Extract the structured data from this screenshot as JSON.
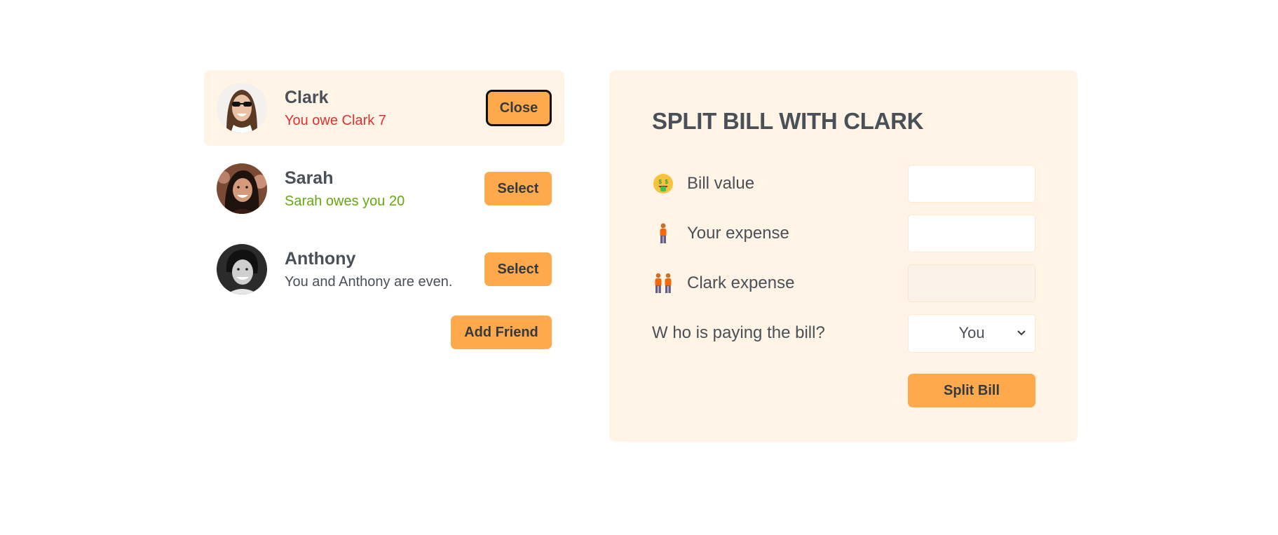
{
  "friends": [
    {
      "name": "Clark",
      "status": "You owe Clark 7",
      "status_type": "red",
      "button": "Close",
      "selected": true
    },
    {
      "name": "Sarah",
      "status": "Sarah owes you 20",
      "status_type": "green",
      "button": "Select",
      "selected": false
    },
    {
      "name": "Anthony",
      "status": "You and Anthony are even.",
      "status_type": "neutral",
      "button": "Select",
      "selected": false
    }
  ],
  "add_friend_label": "Add Friend",
  "form": {
    "title": "Split bill with Clark",
    "bill_value_label": "Bill value",
    "bill_value": "",
    "your_expense_label": "Your expense",
    "your_expense": "",
    "friend_expense_label": "Clark expense",
    "friend_expense": "",
    "payer_label": "W ho is paying the bill?",
    "payer_value": "You",
    "submit_label": "Split Bill"
  },
  "colors": {
    "accent": "#ffa94d",
    "panel_bg": "#fff4e6",
    "text": "#495057",
    "red": "#e03131",
    "green": "#66a80f"
  },
  "icons": {
    "bill_value": "money-mouth-face-icon",
    "your_expense": "person-standing-icon",
    "friend_expense": "two-people-icon",
    "select_arrow": "chevron-down-icon"
  }
}
